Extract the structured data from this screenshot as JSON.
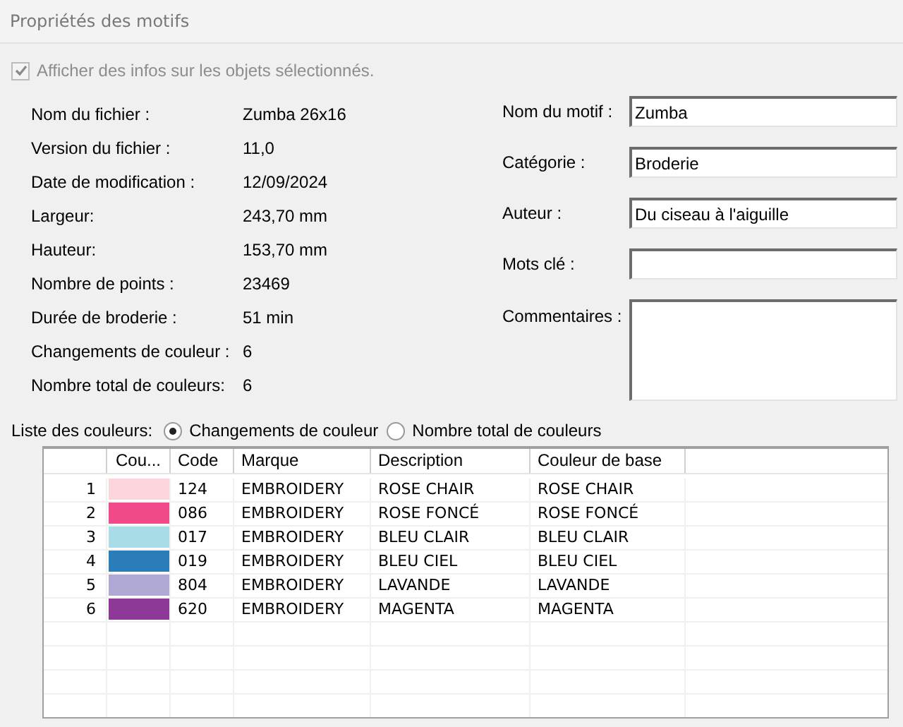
{
  "window": {
    "title": "Propriétés des motifs"
  },
  "show_info": {
    "label": "Afficher des infos sur les objets sélectionnés.",
    "checked": true,
    "disabled": true
  },
  "info": [
    {
      "label": "Nom du fichier :",
      "value": "Zumba 26x16"
    },
    {
      "label": "Version du fichier :",
      "value": "11,0"
    },
    {
      "label": "Date de modification :",
      "value": "12/09/2024"
    },
    {
      "label": "Largeur:",
      "value": "243,70 mm"
    },
    {
      "label": "Hauteur:",
      "value": "153,70 mm"
    },
    {
      "label": "Nombre de points :",
      "value": "23469"
    },
    {
      "label": "Durée de broderie :",
      "value": "51 min"
    },
    {
      "label": "Changements de couleur :",
      "value": "6"
    },
    {
      "label": "Nombre total de couleurs:",
      "value": "6"
    }
  ],
  "fields": [
    {
      "label": "Nom du motif :",
      "value": "Zumba",
      "kind": "line"
    },
    {
      "label": "Catégorie :",
      "value": "Broderie",
      "kind": "line"
    },
    {
      "label": "Auteur :",
      "value": "Du ciseau à l'aiguille",
      "kind": "line"
    },
    {
      "label": "Mots clé :",
      "kind": "line"
    },
    {
      "label": "Commentaires :",
      "kind": "area"
    }
  ],
  "color_list": {
    "label": "Liste des couleurs:",
    "options": [
      {
        "label": "Changements de couleur",
        "selected": true
      },
      {
        "label": "Nombre total de couleurs",
        "selected": false
      }
    ]
  },
  "table": {
    "columns": [
      "Cou...",
      "Code",
      "Marque",
      "Description",
      "Couleur de base"
    ],
    "rows": [
      {
        "number": "1",
        "color": "#fcd4dc",
        "code": "124",
        "brand": "EMBROIDERY",
        "description": "ROSE CHAIR",
        "base": "ROSE CHAIR"
      },
      {
        "number": "2",
        "color": "#f24a88",
        "code": "086",
        "brand": "EMBROIDERY",
        "description": "ROSE FONCÉ",
        "base": "ROSE FONCÉ"
      },
      {
        "number": "3",
        "color": "#a8dde8",
        "code": "017",
        "brand": "EMBROIDERY",
        "description": "BLEU CLAIR",
        "base": "BLEU CLAIR"
      },
      {
        "number": "4",
        "color": "#2a7db8",
        "code": "019",
        "brand": "EMBROIDERY",
        "description": "BLEU CIEL",
        "base": "BLEU CIEL"
      },
      {
        "number": "5",
        "color": "#b0a8d4",
        "code": "804",
        "brand": "EMBROIDERY",
        "description": "LAVANDE",
        "base": "LAVANDE"
      },
      {
        "number": "6",
        "color": "#8e3898",
        "code": "620",
        "brand": "EMBROIDERY",
        "description": "MAGENTA",
        "base": "MAGENTA"
      }
    ]
  }
}
